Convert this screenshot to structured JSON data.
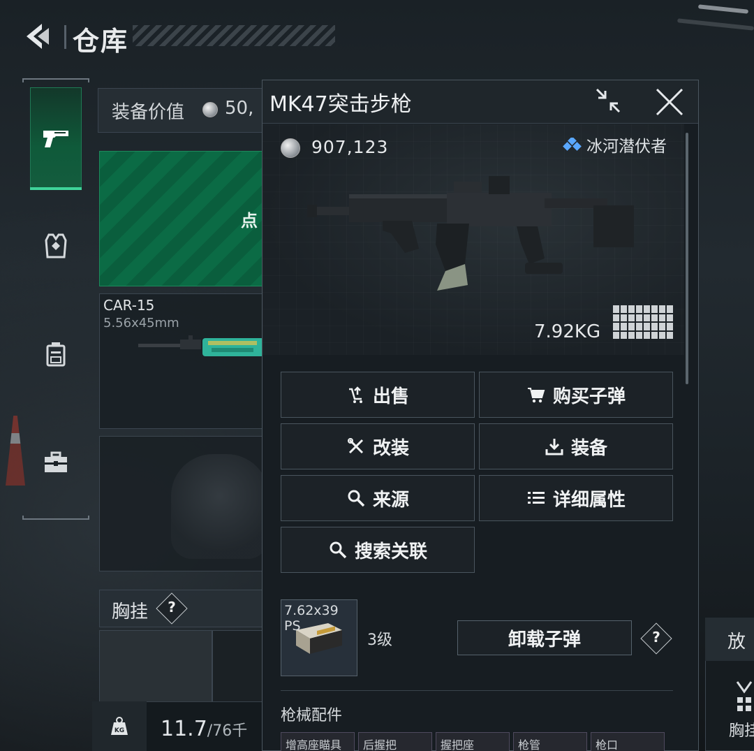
{
  "header": {
    "title": "仓库"
  },
  "equipment_value": {
    "label": "装备价值",
    "value": "50,"
  },
  "inventory": {
    "green_slot_text": "点",
    "primary_weapon": {
      "name": "CAR-15",
      "caliber": "5.56x45mm"
    },
    "chest_rig_label": "胸挂",
    "help_symbol": "?",
    "weight": {
      "current": "11.7",
      "total": "/76千"
    }
  },
  "stash_panel": {
    "title": "放",
    "item_label": "胸挂"
  },
  "item_detail": {
    "title": "MK47突击步枪",
    "price": "907,123",
    "source_name": "冰河潜伏者",
    "weight": "7.92KG",
    "actions": [
      {
        "label": "出售",
        "icon": "sell-icon"
      },
      {
        "label": "购买子弹",
        "icon": "cart-icon"
      },
      {
        "label": "改装",
        "icon": "modify-tools-icon"
      },
      {
        "label": "装备",
        "icon": "equip-download-icon"
      },
      {
        "label": "来源",
        "icon": "search-icon"
      },
      {
        "label": "详细属性",
        "icon": "list-icon"
      },
      {
        "label": "搜索关联",
        "icon": "search-icon"
      }
    ],
    "ammo": {
      "name": "7.62x39",
      "sub": "PS",
      "level": "3级",
      "unload_label": "卸载子弹",
      "help_symbol": "?"
    },
    "attachments_title": "枪械配件",
    "attachments": [
      "增高座瞄具",
      "后握把",
      "握把座",
      "枪管",
      "枪口"
    ]
  },
  "colors": {
    "accent_green": "#3fd39a",
    "source_blue": "#5aa8ff"
  }
}
